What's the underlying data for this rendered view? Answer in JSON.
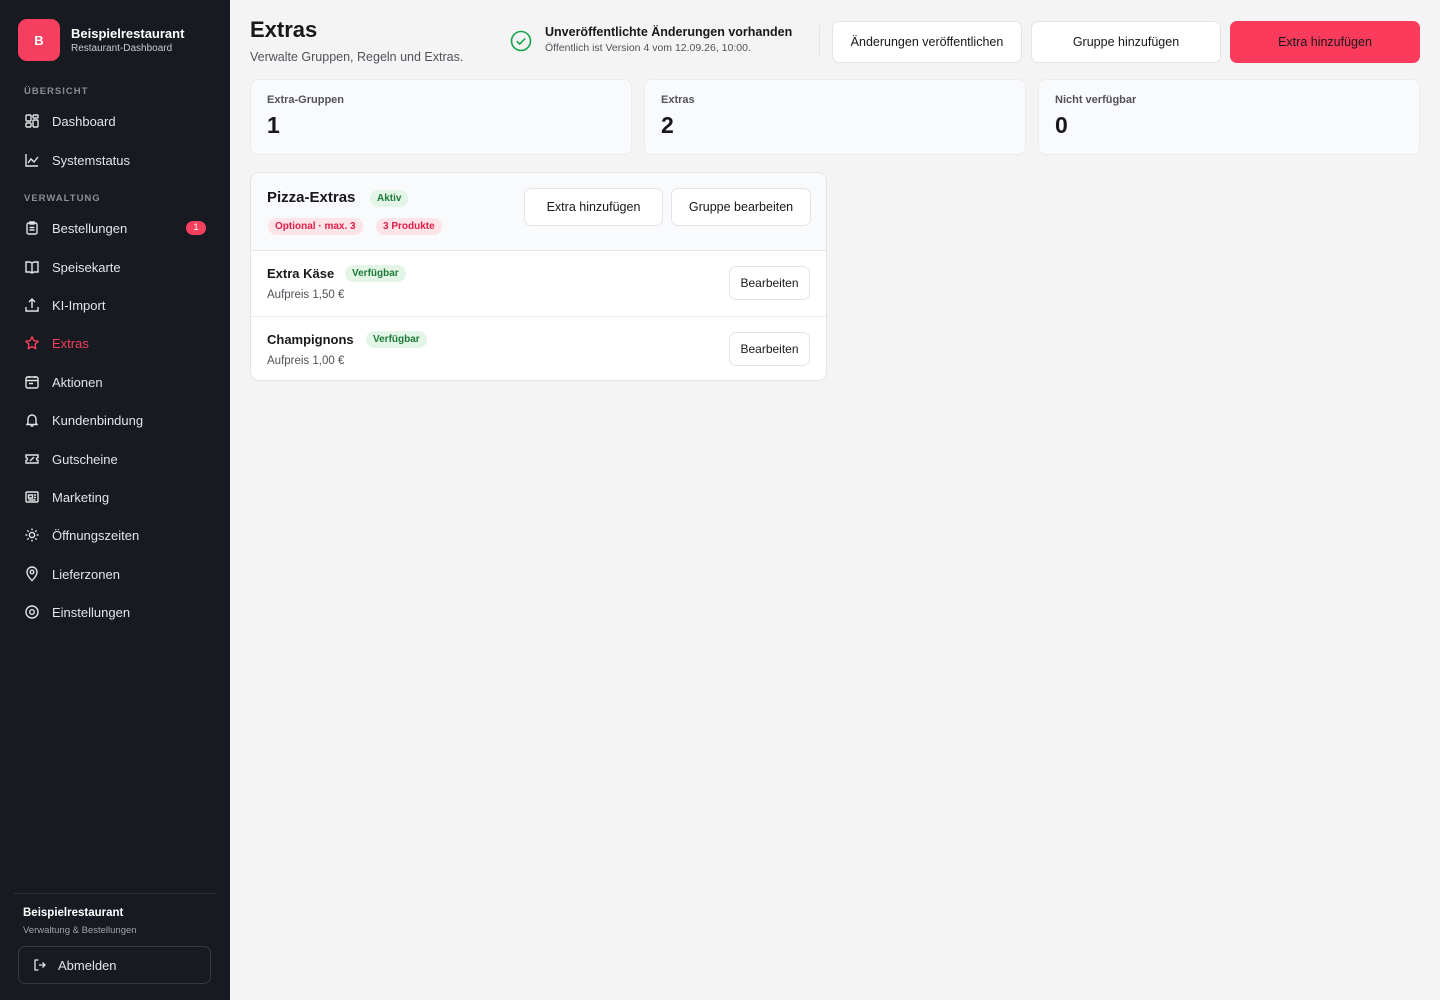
{
  "brand": {
    "logo_letter": "B",
    "name": "Beispielrestaurant",
    "subtitle": "Restaurant-Dashboard"
  },
  "sidebar": {
    "sections": [
      {
        "label": "ÜBERSICHT"
      },
      {
        "label": "VERWALTUNG"
      }
    ],
    "items": [
      {
        "label": "Dashboard",
        "icon": "dashboard-icon"
      },
      {
        "label": "Systemstatus",
        "icon": "chart-icon"
      },
      {
        "label": "Bestellungen",
        "icon": "clipboard-icon",
        "badge": "1"
      },
      {
        "label": "Speisekarte",
        "icon": "book-icon"
      },
      {
        "label": "KI-Import",
        "icon": "upload-icon"
      },
      {
        "label": "Extras",
        "icon": "star-icon",
        "active": true
      },
      {
        "label": "Aktionen",
        "icon": "calendar-icon"
      },
      {
        "label": "Kundenbindung",
        "icon": "bell-icon"
      },
      {
        "label": "Gutscheine",
        "icon": "ticket-icon"
      },
      {
        "label": "Marketing",
        "icon": "newspaper-icon"
      },
      {
        "label": "Öffnungszeiten",
        "icon": "sun-icon"
      },
      {
        "label": "Lieferzonen",
        "icon": "map-pin-icon"
      },
      {
        "label": "Einstellungen",
        "icon": "gear-icon"
      }
    ],
    "footer": {
      "name": "Beispielrestaurant",
      "subtitle": "Verwaltung & Bestellungen",
      "logout_label": "Abmelden"
    }
  },
  "header": {
    "title": "Extras",
    "subtitle": "Verwalte Gruppen, Regeln und Extras.",
    "status_title": "Unveröffentlichte Änderungen vorhanden",
    "status_sub": "Öffentlich ist Version 4 vom 12.09.26, 10:00.",
    "publish_label": "Änderungen veröffentlichen",
    "add_group_label": "Gruppe hinzufügen",
    "add_extra_label": "Extra hinzufügen"
  },
  "stats": [
    {
      "label": "Extra-Gruppen",
      "value": "1"
    },
    {
      "label": "Extras",
      "value": "2"
    },
    {
      "label": "Nicht verfügbar",
      "value": "0"
    }
  ],
  "group": {
    "title": "Pizza-Extras",
    "status": "Aktiv",
    "rule": "Optional · max. 3",
    "products": "3 Produkte",
    "add_extra_label": "Extra hinzufügen",
    "edit_group_label": "Gruppe bearbeiten",
    "items": [
      {
        "name": "Extra Käse",
        "status": "Verfügbar",
        "price": "Aufpreis 1,50 €",
        "edit_label": "Bearbeiten"
      },
      {
        "name": "Champignons",
        "status": "Verfügbar",
        "price": "Aufpreis 1,00 €",
        "edit_label": "Bearbeiten"
      }
    ]
  },
  "colors": {
    "accent": "#f43f5e",
    "sidebar_bg": "#171a21",
    "success": "#16a34a"
  }
}
